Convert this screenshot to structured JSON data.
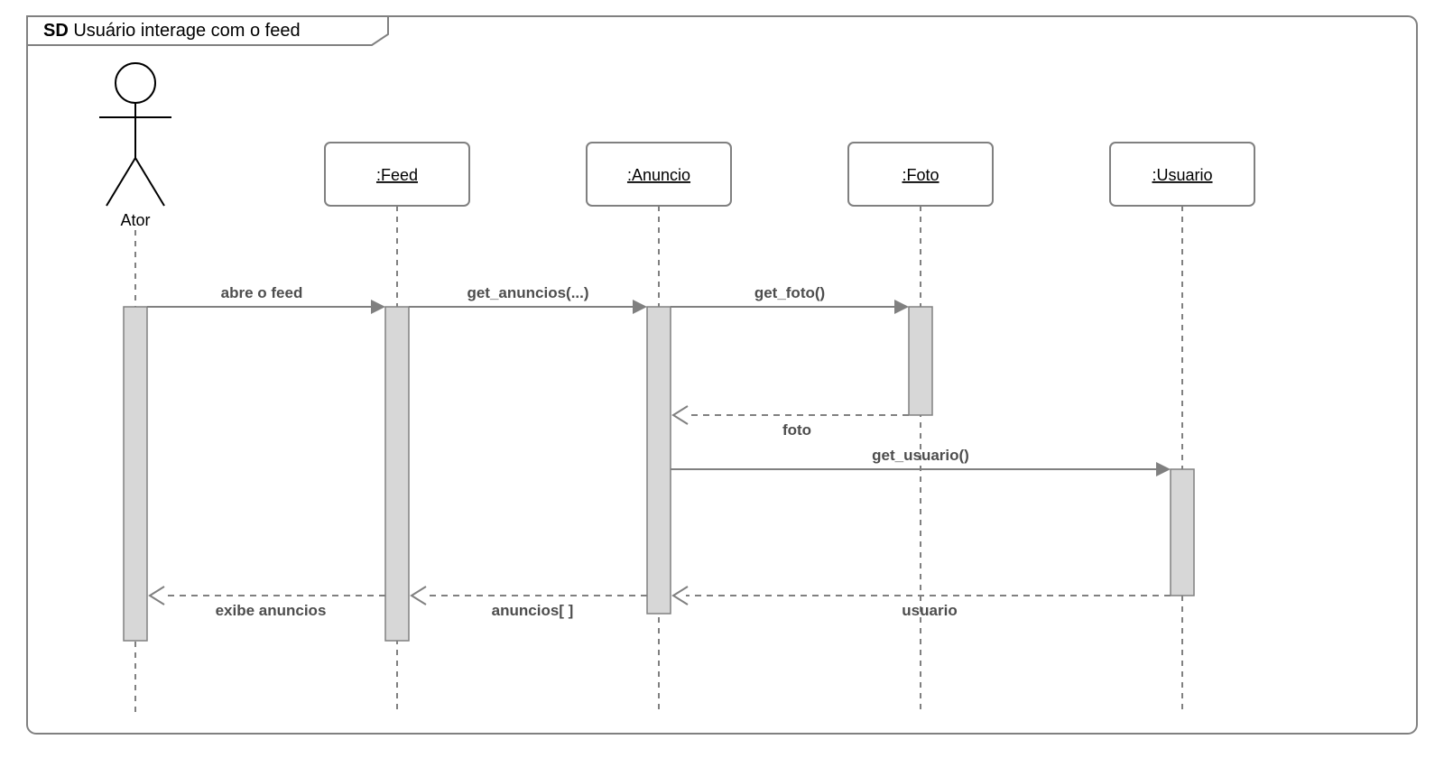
{
  "frame": {
    "label_prefix": "SD",
    "title": "Usuário interage com o feed"
  },
  "actor": {
    "name": "Ator"
  },
  "participants": {
    "feed": ":Feed",
    "anuncio": ":Anuncio",
    "foto": ":Foto",
    "usuario": ":Usuario"
  },
  "messages": {
    "m1": "abre o feed",
    "m2": "get_anuncios(...)",
    "m3": "get_foto()",
    "r3": "foto",
    "m4": "get_usuario()",
    "r4": "usuario",
    "r2": "anuncios[ ]",
    "r1": "exibe anuncios"
  }
}
